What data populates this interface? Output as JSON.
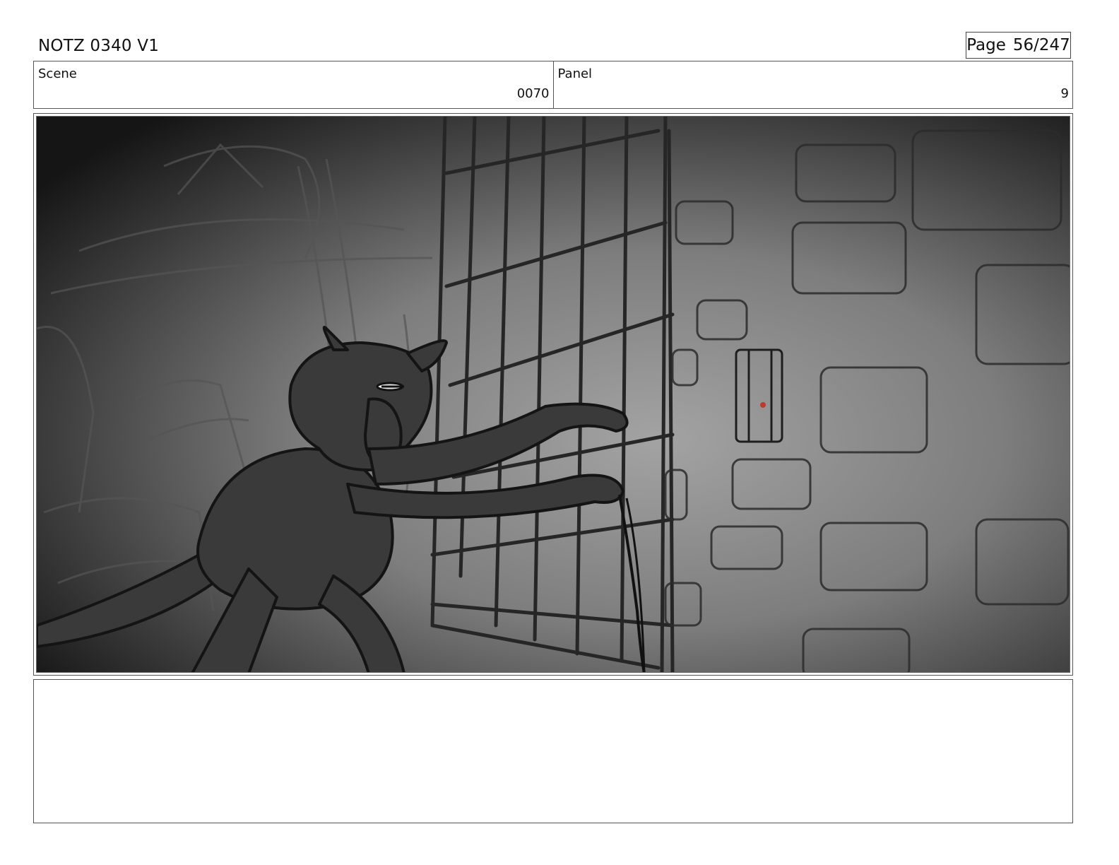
{
  "header": {
    "title": "NOTZ 0340 V1",
    "page_label": "Page",
    "page_number": "56/247"
  },
  "scene": {
    "label": "Scene",
    "value": "0070"
  },
  "panel": {
    "label": "Panel",
    "value": "9"
  },
  "frame": {
    "description_icon": "storyboard-sketch",
    "colors": {
      "vignette_dark": "#141414",
      "light_center": "#9a9a9a",
      "character_fill": "#3a3a3a",
      "stroke": "#1e1e1e",
      "button_accent": "#c0392b"
    }
  },
  "notes": {
    "text": ""
  }
}
